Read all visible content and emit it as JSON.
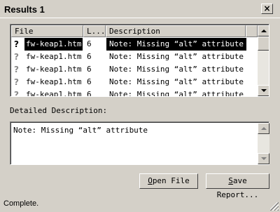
{
  "window": {
    "title": "Results 1",
    "close_glyph": "×"
  },
  "list": {
    "columns": [
      {
        "label": "File"
      },
      {
        "label": "L..."
      },
      {
        "label": "Description"
      }
    ],
    "rows": [
      {
        "icon": "question-icon",
        "file": "fw-keap1.htm",
        "line": "6",
        "desc": "Note: Missing “alt” attribute",
        "selected": true
      },
      {
        "icon": "question-icon",
        "file": "fw-keap1.htm",
        "line": "6",
        "desc": "Note: Missing “alt” attribute"
      },
      {
        "icon": "question-icon",
        "file": "fw-keap1.htm",
        "line": "6",
        "desc": "Note: Missing “alt” attribute"
      },
      {
        "icon": "question-icon",
        "file": "fw-keap1.htm",
        "line": "6",
        "desc": "Note: Missing “alt” attribute"
      },
      {
        "icon": "question-icon",
        "file": "fw-keap1.htm",
        "line": "6",
        "desc": "Note: Missing “alt” attribute"
      }
    ]
  },
  "details": {
    "label": "Detailed Description:",
    "text": "Note: Missing “alt” attribute"
  },
  "buttons": {
    "open_file": {
      "mnemonic": "O",
      "rest": "pen File"
    },
    "save_report": {
      "mnemonic": "S",
      "rest": "ave Report..."
    }
  },
  "status": {
    "text": "Complete."
  },
  "colors": {
    "selection": "#000000",
    "face": "#d4d0c8"
  }
}
